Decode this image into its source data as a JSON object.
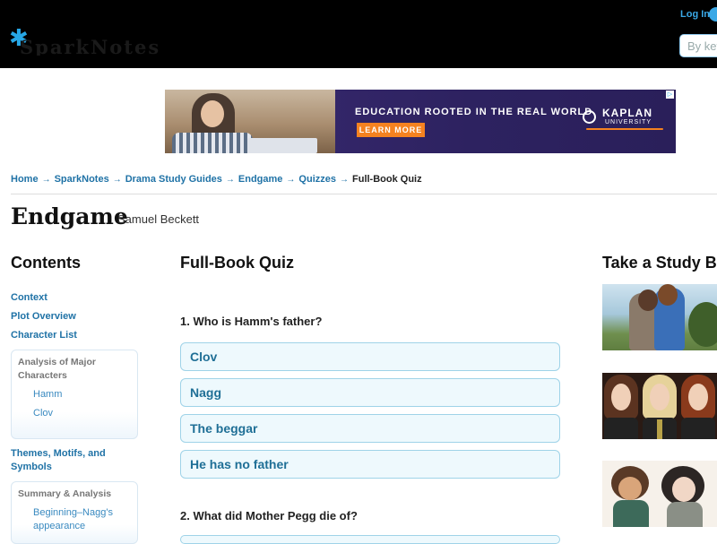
{
  "header": {
    "logo_text": "SparkNotes",
    "login_label": "Log In",
    "search_placeholder": "By keyword"
  },
  "ad": {
    "headline": "EDUCATION ROOTED IN THE REAL WORLD",
    "button_label": "LEARN MORE",
    "brand_name": "KAPLAN",
    "brand_sub": "UNIVERSITY"
  },
  "breadcrumb": {
    "items": [
      "Home",
      "SparkNotes",
      "Drama Study Guides",
      "Endgame",
      "Quizzes"
    ],
    "current": "Full-Book Quiz",
    "separator": "→"
  },
  "book": {
    "title": "Endgame",
    "author": "Samuel Beckett"
  },
  "sidebar": {
    "title": "Contents",
    "links": [
      "Context",
      "Plot Overview",
      "Character List"
    ],
    "analysis_box": {
      "heading_line1": "Analysis of Major",
      "heading_line2": "Characters",
      "items": [
        "Hamm",
        "Clov"
      ]
    },
    "themes_line1": "Themes, Motifs, and",
    "themes_line2": "Symbols",
    "summary_box": {
      "heading": "Summary & Analysis",
      "item_line1": "Beginning–Nagg's",
      "item_line2": "appearance"
    }
  },
  "quiz": {
    "title": "Full-Book Quiz",
    "questions": [
      {
        "text": "1. Who is Hamm's father?",
        "answers": [
          "Clov",
          "Nagg",
          "The beggar",
          "He has no father"
        ]
      },
      {
        "text": "2. What did Mother Pegg die of?"
      }
    ]
  },
  "right_column": {
    "title": "Take a Study Break"
  },
  "colors": {
    "header_bg": "#000000",
    "link_blue": "#1f72a6",
    "answer_bg": "#eef9fd",
    "answer_border": "#9fd3e8",
    "ad_orange": "#f58220",
    "ad_purple": "#3a2a72"
  }
}
